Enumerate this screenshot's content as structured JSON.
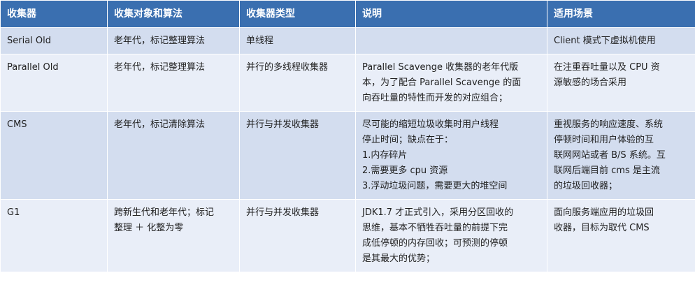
{
  "headers": [
    "收集器",
    "收集对象和算法",
    "收集器类型",
    "说明",
    "适用场景"
  ],
  "rows": [
    {
      "collector": "Serial Old",
      "object": "老年代，标记整理算法",
      "type": "单线程",
      "desc": [],
      "scene": [
        "Client 模式下虚拟机使用"
      ]
    },
    {
      "collector": "Parallel Old",
      "object": "老年代，标记整理算法",
      "type": "并行的多线程收集器",
      "desc": [
        "Parallel Scavenge 收集器的老年代版",
        "本，为了配合 Parallel Scavenge 的面",
        "向吞吐量的特性而开发的对应组合；"
      ],
      "scene": [
        "在注重吞吐量以及 CPU 资",
        "源敏感的场合采用"
      ]
    },
    {
      "collector": "CMS",
      "object": "老年代，标记清除算法",
      "type": "并行与并发收集器",
      "desc": [
        "尽可能的缩短垃圾收集时用户线程",
        "停止时间；缺点在于：",
        "1.内存碎片",
        "2.需要更多 cpu 资源",
        "3.浮动垃圾问题，需要更大的堆空间"
      ],
      "scene": [
        "重视服务的响应速度、系统",
        "停顿时间和用户体验的互",
        "联网网站或者 B/S 系统。互",
        "联网后端目前 cms 是主流",
        "的垃圾回收器；"
      ]
    },
    {
      "collector": "G1",
      "object": [
        "跨新生代和老年代；标记",
        "整理 ＋ 化整为零"
      ],
      "type": "并行与并发收集器",
      "desc": [
        "JDK1.7 才正式引入，采用分区回收的",
        "思维，基本不牺牲吞吐量的前提下完",
        "成低停顿的内存回收；可预测的停顿",
        "是其最大的优势；"
      ],
      "scene": [
        "面向服务端应用的垃圾回",
        "收器，目标为取代 CMS"
      ]
    }
  ],
  "colors": {
    "header_bg": "#3a6fb0",
    "row_odd_bg": "#d3ddef",
    "row_even_bg": "#e9eef8"
  }
}
